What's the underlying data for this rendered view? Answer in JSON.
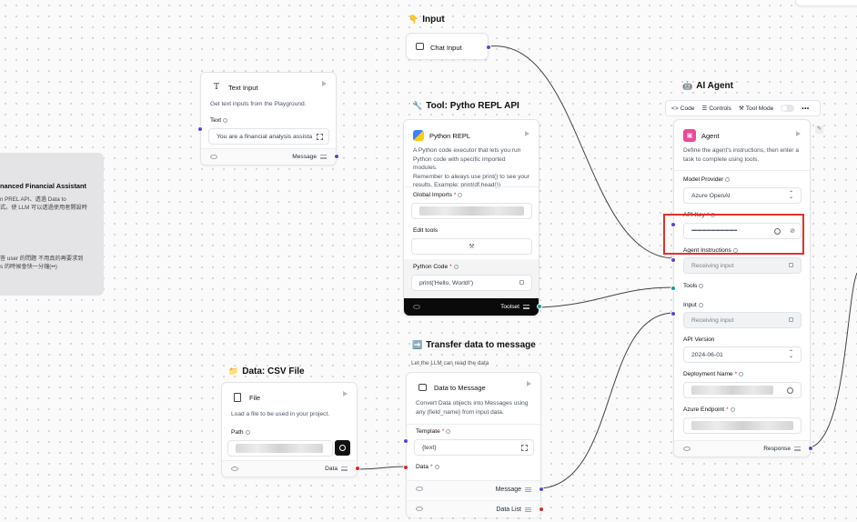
{
  "groups": {
    "input": "Input",
    "tool": "Tool: Pytho REPL API",
    "ai_agent": "AI Agent",
    "csv": "Data: CSV File",
    "transfer": "Transfer data to message"
  },
  "group_emojis": {
    "input": "👇",
    "tool": "🔧",
    "ai_agent": "🤖",
    "csv": "📁",
    "transfer": "➡️"
  },
  "chat_input": {
    "title": "Chat Input"
  },
  "text_input": {
    "title": "Text Input",
    "desc": "Get text inputs from the Playground.",
    "field_label": "Text",
    "value": "You are a financial analysis assista",
    "output": "Message"
  },
  "note": {
    "title": "nanced Financial Assistant",
    "line1": "n PREL API、透過 Data to",
    "line2": "式。使 LLM 可以透過使用者開設時",
    "line3": "答 user 的問題 不用真的再要求到",
    "line4": "s 的時候會快一分鐘(••)"
  },
  "python_repl": {
    "title": "Python REPL",
    "desc1": "A Python code executor that lets you run",
    "desc2": "Python code with specific imported modules.",
    "desc3": "Remember to always use print() to see your",
    "desc4": "results. Example: print(df.head())",
    "global_imports_label": "Global Imports",
    "edit_tools_label": "Edit tools",
    "python_code_label": "Python Code",
    "python_code_value": "print('Hello, World!')",
    "output": "Toolset"
  },
  "file": {
    "title": "File",
    "desc": "Load a file to be used in your project.",
    "path_label": "Path",
    "output": "Data"
  },
  "data_to_message": {
    "note": "Let the LLM can read the data",
    "title": "Data to Message",
    "desc1": "Convert Data objects into Messages using",
    "desc2": "any {field_name} from input data.",
    "template_label": "Template",
    "template_value": "{text}",
    "data_label": "Data",
    "output_message": "Message",
    "output_data_list": "Data List"
  },
  "agent_toolbar": {
    "code": "Code",
    "controls": "Controls",
    "tool_mode": "Tool Mode"
  },
  "agent": {
    "title": "Agent",
    "desc1": "Define the agent's instructions, then enter a",
    "desc2": "task to complete using tools.",
    "model_provider_label": "Model Provider",
    "model_provider_value": "Azure OpenAI",
    "api_key_label": "API Key",
    "api_key_value": "••••••••••••••••••••••••••••••••••••••••",
    "agent_instructions_label": "Agent Instructions",
    "agent_instructions_value": "Receiving input",
    "tools_label": "Tools",
    "input_label": "Input",
    "input_value": "Receiving input",
    "api_version_label": "API Version",
    "api_version_value": "2024-06-01",
    "deployment_label": "Deployment Name",
    "endpoint_label": "Azure Endpoint",
    "output": "Response"
  },
  "colors": {
    "highlight": "#e0322b",
    "handle_blue": "#4f46e5",
    "handle_red": "#dc2626",
    "handle_teal": "#0e9f9f"
  }
}
